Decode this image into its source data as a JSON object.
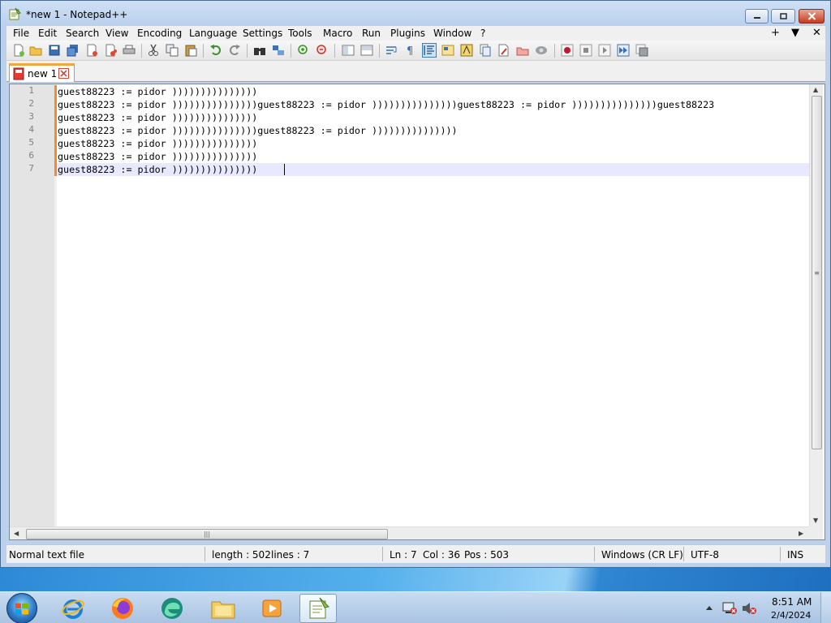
{
  "window": {
    "title": "*new 1 - Notepad++",
    "controls": {
      "minimize": "minimize",
      "maximize": "maximize",
      "close": "close"
    }
  },
  "menu": {
    "items": [
      "File",
      "Edit",
      "Search",
      "View",
      "Encoding",
      "Language",
      "Settings",
      "Tools",
      "Macro",
      "Run",
      "Plugins",
      "Window",
      "?"
    ],
    "right": [
      "+",
      "▼",
      "✕"
    ]
  },
  "toolbar": {
    "buttons": [
      "new-file",
      "open-file",
      "save",
      "save-all",
      "close",
      "close-all",
      "print",
      "cut",
      "copy",
      "paste",
      "undo",
      "redo",
      "find",
      "replace",
      "zoom-in",
      "zoom-out",
      "sync-vertical",
      "sync-horizontal",
      "word-wrap",
      "show-all-characters",
      "indent-guide",
      "udl",
      "doc-map",
      "function-list",
      "folder-as-workspace",
      "monitoring",
      "record-macro",
      "stop-recording",
      "playback",
      "run-multiple",
      "save-macro"
    ],
    "active_button": "indent-guide"
  },
  "tabs": [
    {
      "label": "new 1",
      "modified": true
    }
  ],
  "editor": {
    "line_numbers": [
      "1",
      "2",
      "3",
      "4",
      "5",
      "6",
      "7"
    ],
    "lines": [
      "guest88223 := pidor )))))))))))))))",
      "guest88223 := pidor )))))))))))))))guest88223 := pidor )))))))))))))))guest88223 := pidor )))))))))))))))guest88223",
      "guest88223 := pidor )))))))))))))))",
      "guest88223 := pidor )))))))))))))))guest88223 := pidor )))))))))))))))",
      "guest88223 := pidor )))))))))))))))",
      "guest88223 := pidor )))))))))))))))",
      "guest88223 := pidor )))))))))))))))"
    ],
    "current_line": 7
  },
  "statusbar": {
    "file_type": "Normal text file",
    "length": "length : 502",
    "lines": "lines : 7",
    "ln": "Ln : 7",
    "col": "Col : 36",
    "pos": "Pos : 503",
    "eol": "Windows (CR LF)",
    "encoding": "UTF-8",
    "mode": "INS"
  },
  "taskbar": {
    "apps": [
      "internet-explorer",
      "firefox",
      "edge",
      "file-explorer",
      "media-player",
      "notepad-plus-plus"
    ],
    "active_app": "notepad-plus-plus",
    "tray_icons": [
      "show-hidden-icons",
      "network-icon",
      "volume-muted-icon"
    ],
    "clock": {
      "time": "8:51 AM",
      "date": "2/4/2024"
    }
  },
  "colors": {
    "accent_tab": "#f2a73c",
    "modified_marker": "#f28c28",
    "current_line": "#e8e8ff",
    "gutter": "#e4e4e4"
  }
}
